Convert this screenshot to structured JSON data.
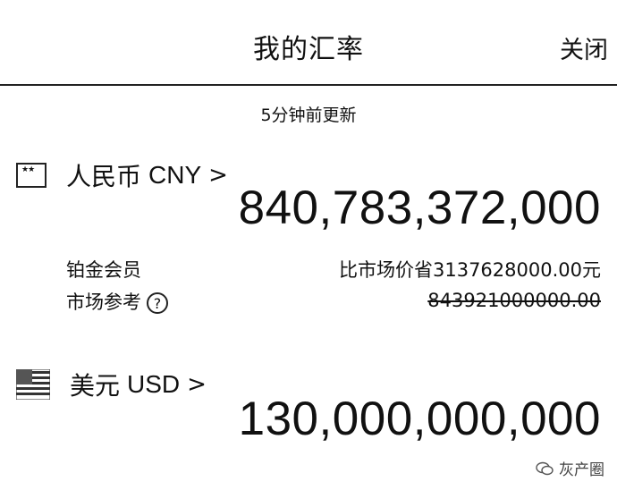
{
  "header": {
    "title": "我的汇率",
    "close_label": "关闭"
  },
  "updated_text": "5分钟前更新",
  "cny": {
    "name": "人民币",
    "code": "CNY",
    "chevron": ">",
    "amount": "840,783,372,000",
    "member_label": "铂金会员",
    "savings_text": "比市场价省3137628000.00元",
    "market_label": "市场参考",
    "help_symbol": "?",
    "market_value": "843921000000.00",
    "flag_icon": "cn-flag-icon"
  },
  "usd": {
    "name": "美元",
    "code": "USD",
    "chevron": ">",
    "amount": "130,000,000,000",
    "flag_icon": "us-flag-icon"
  },
  "watermark": {
    "text": "灰产圈"
  }
}
